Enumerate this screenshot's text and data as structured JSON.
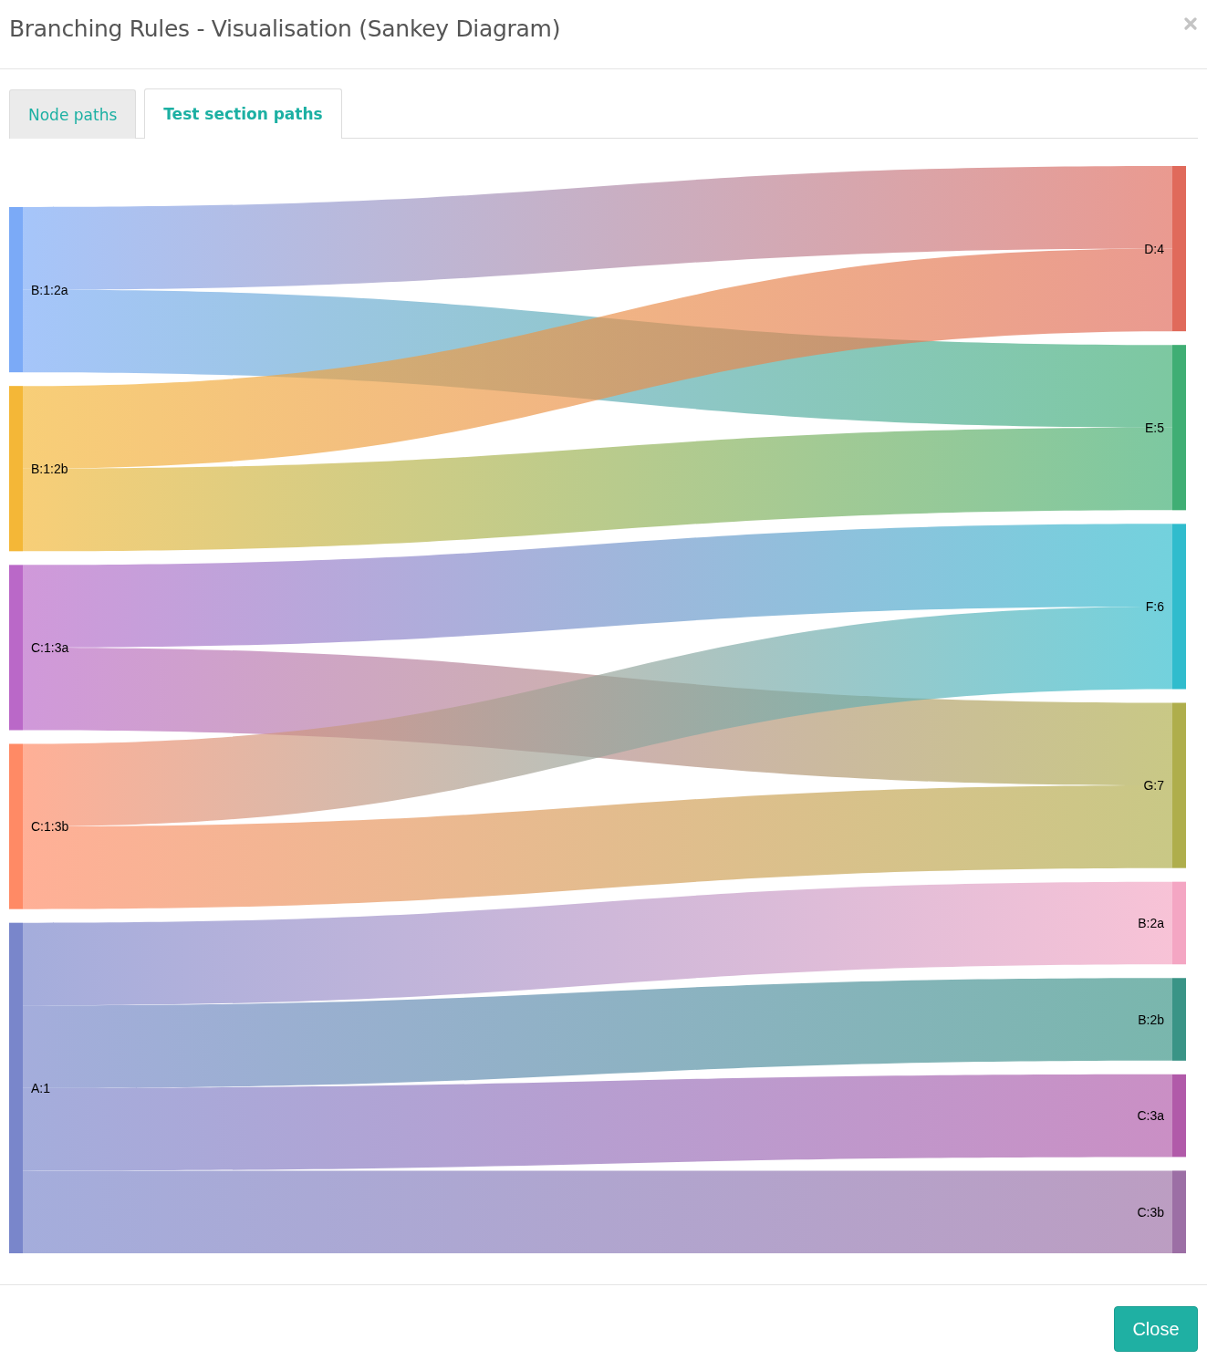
{
  "dialog": {
    "title": "Branching Rules - Visualisation (Sankey Diagram)"
  },
  "tabs": [
    {
      "label": "Node paths",
      "selected": false
    },
    {
      "label": "Test section paths",
      "selected": true
    }
  ],
  "sankey": {
    "sources": [
      {
        "label": "B:1:2a",
        "color": "#7baaf7"
      },
      {
        "label": "B:1:2b",
        "color": "#f4b737"
      },
      {
        "label": "C:1:3a",
        "color": "#ba68c8"
      },
      {
        "label": "C:1:3b",
        "color": "#ff8a65"
      },
      {
        "label": "A:1",
        "color": "#7986cb"
      }
    ],
    "targets": [
      {
        "label": "D:4",
        "color": "#e06a5b"
      },
      {
        "label": "E:5",
        "color": "#3fae74"
      },
      {
        "label": "F:6",
        "color": "#30bccd"
      },
      {
        "label": "G:7",
        "color": "#afae4c"
      },
      {
        "label": "B:2a",
        "color": "#f4a6c3"
      },
      {
        "label": "B:2b",
        "color": "#3a9486"
      },
      {
        "label": "C:3a",
        "color": "#b15aa9"
      },
      {
        "label": "C:3b",
        "color": "#9c6fa5"
      }
    ]
  },
  "footer": {
    "button": "Close"
  }
}
